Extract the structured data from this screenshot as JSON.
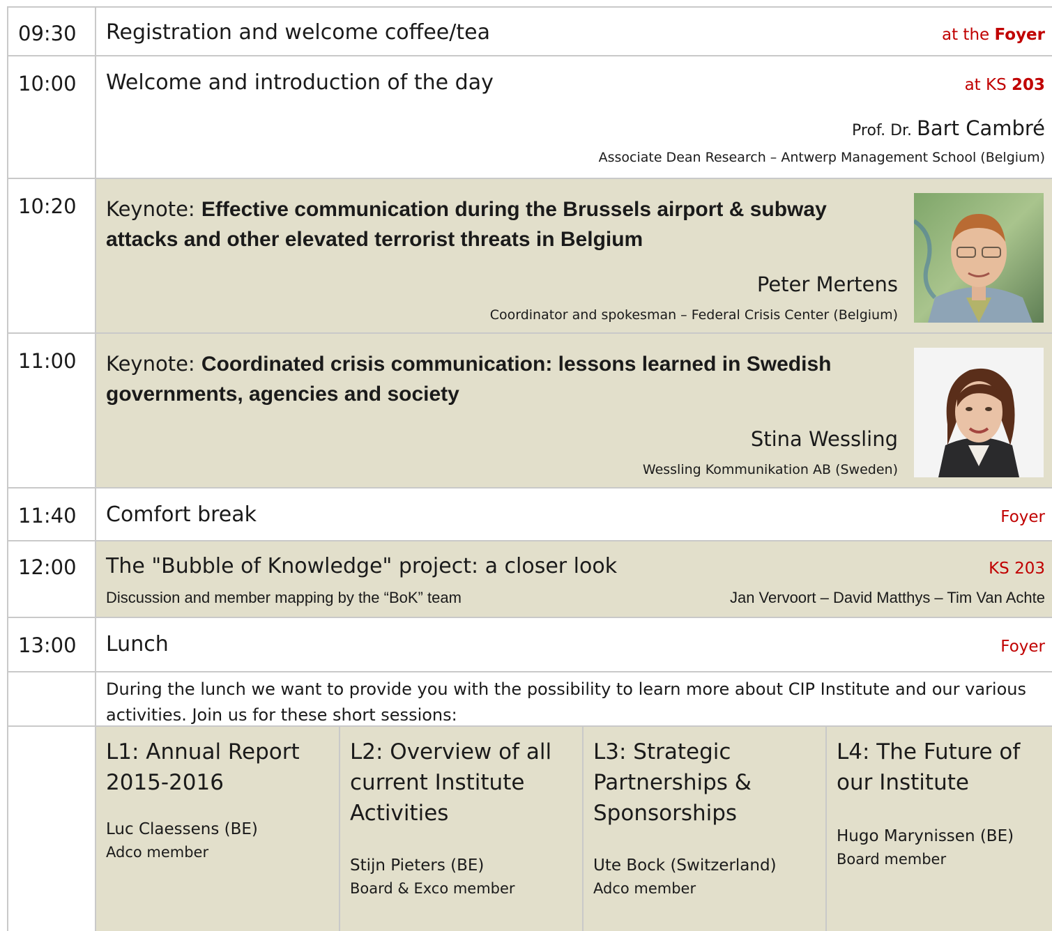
{
  "rows": {
    "registration": {
      "time": "09:30",
      "title": "Registration and welcome coffee/tea",
      "loc_pre": "at the ",
      "loc_bold": "Foyer"
    },
    "welcome": {
      "time": "10:00",
      "title": "Welcome and introduction of the day",
      "loc_pre": "at KS ",
      "loc_bold": "203",
      "speaker_pre": "Prof. Dr. ",
      "speaker_name": "Bart Cambré",
      "speaker_role": "Associate Dean Research – Antwerp Management School (Belgium)"
    },
    "keynote1": {
      "time": "10:20",
      "label": "Keynote: ",
      "title": "Effective communication during the Brussels airport & subway attacks and other elevated terrorist threats in Belgium",
      "speaker_name": "Peter Mertens",
      "speaker_role": "Coordinator and spokesman – Federal Crisis Center (Belgium)"
    },
    "keynote2": {
      "time": "11:00",
      "label": "Keynote: ",
      "title": "Coordinated crisis communication: lessons learned in Swedish governments, agencies and society",
      "speaker_name": "Stina Wessling",
      "speaker_role": "Wessling Kommunikation AB (Sweden)"
    },
    "break": {
      "time": "11:40",
      "title": "Comfort break",
      "loc": "Foyer"
    },
    "bok": {
      "time": "12:00",
      "title": "The \"Bubble of Knowledge\" project: a closer look",
      "loc": "KS 203",
      "subtitle": "Discussion and member mapping by the “BoK” team",
      "people": "Jan Vervoort – David Matthys – Tim Van Achte"
    },
    "lunch": {
      "time": "13:00",
      "title": "Lunch",
      "loc": "Foyer"
    },
    "lunch_info": {
      "text": "During the lunch we want to provide you with the possibility to learn more about CIP Institute and our various activities. Join us for these short sessions:"
    }
  },
  "sessions": [
    {
      "title": "L1: Annual Report 2015-2016",
      "name": "Luc Claessens (BE)",
      "role": "Adco member"
    },
    {
      "title": "L2: Overview of all current Institute Activities",
      "name": "Stijn Pieters (BE)",
      "role": "Board & Exco member"
    },
    {
      "title": "L3: Strategic Partnerships & Sponsorships",
      "name": "Ute Bock (Switzerland)",
      "role": "Adco member"
    },
    {
      "title": "L4: The Future of our Institute",
      "name": "Hugo Marynissen (BE)",
      "role": "Board member"
    }
  ],
  "colors": {
    "accent_red": "#c00000",
    "shade": "#e2dfcb",
    "grid": "#c9c9c9"
  }
}
